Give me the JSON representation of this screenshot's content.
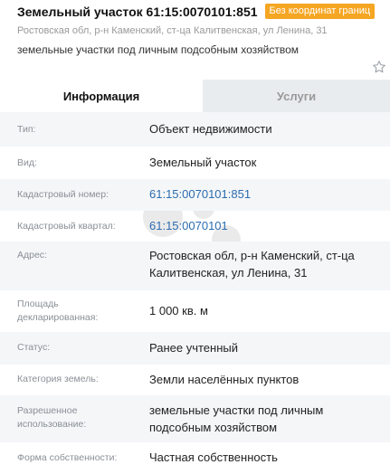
{
  "header": {
    "title": "Земельный участок 61:15:0070101:851",
    "badge": "Без координат границ",
    "address": "Ростовская обл, р-н Каменский, ст-ца Калитвенская, ул Ленина, 31",
    "purpose": "земельные участки под личным подсобным хозяйством"
  },
  "tabs": [
    {
      "label": "Информация",
      "active": true
    },
    {
      "label": "Услуги",
      "active": false
    }
  ],
  "rows": [
    {
      "label": "Тип:",
      "value": "Объект недвижимости"
    },
    {
      "label": "Вид:",
      "value": "Земельный участок"
    },
    {
      "label": "Кадастровый номер:",
      "value": "61:15:0070101:851",
      "link": true
    },
    {
      "label": "Кадастровый квартал:",
      "value": "61:15:0070101",
      "link": true
    },
    {
      "label": "Адрес:",
      "value": "Ростовская обл, р-н Каменский, ст-ца Калитвенская, ул Ленина, 31"
    },
    {
      "label": "Площадь декларированная:",
      "value": "1 000 кв. м"
    },
    {
      "label": "Статус:",
      "value": "Ранее учтенный"
    },
    {
      "label": "Категория земель:",
      "value": "Земли населённых пунктов"
    },
    {
      "label": "Разрешенное использование:",
      "value": "земельные участки под личным подсобным хозяйством"
    },
    {
      "label": "Форма собственности:",
      "value": "Частная собственность"
    }
  ],
  "colors": {
    "badge": "#f5a623",
    "link": "#2b6cb0",
    "row_alt": "#f4f6f8",
    "tab_inactive": "#e9ecef"
  },
  "icons": [
    "star-icon",
    "avito-watermark"
  ]
}
